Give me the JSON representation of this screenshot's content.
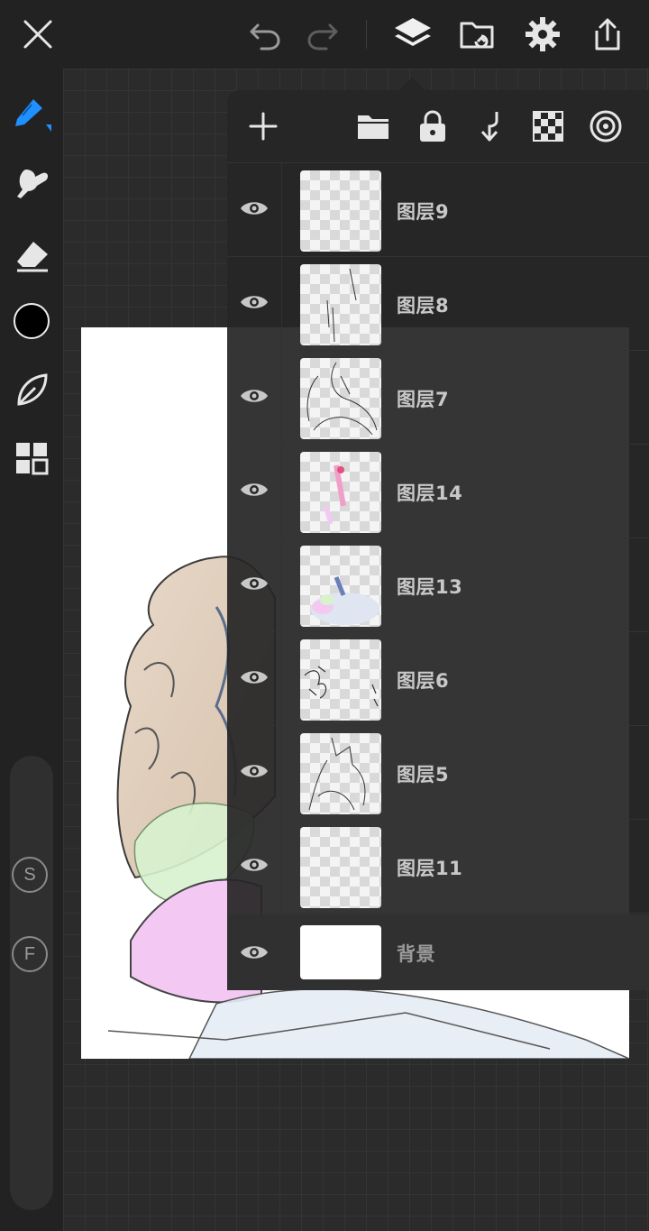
{
  "toolbar": {
    "close_icon": "close-icon",
    "undo_icon": "undo-icon",
    "redo_icon": "redo-icon",
    "layers_icon": "layers-icon",
    "import_icon": "import-icon",
    "settings_icon": "gear-icon",
    "share_icon": "share-icon"
  },
  "sidebar": {
    "active_color": "#000000",
    "accent_color": "#1e90ff",
    "s_label": "S",
    "f_label": "F"
  },
  "layers_panel": {
    "layers": [
      {
        "name": "图层9",
        "visible": true
      },
      {
        "name": "图层8",
        "visible": true
      },
      {
        "name": "图层7",
        "visible": true
      },
      {
        "name": "图层14",
        "visible": true
      },
      {
        "name": "图层13",
        "visible": true
      },
      {
        "name": "图层6",
        "visible": true
      },
      {
        "name": "图层5",
        "visible": true
      },
      {
        "name": "图层11",
        "visible": true
      }
    ],
    "background_layer": {
      "name": "背景",
      "visible": true
    }
  }
}
